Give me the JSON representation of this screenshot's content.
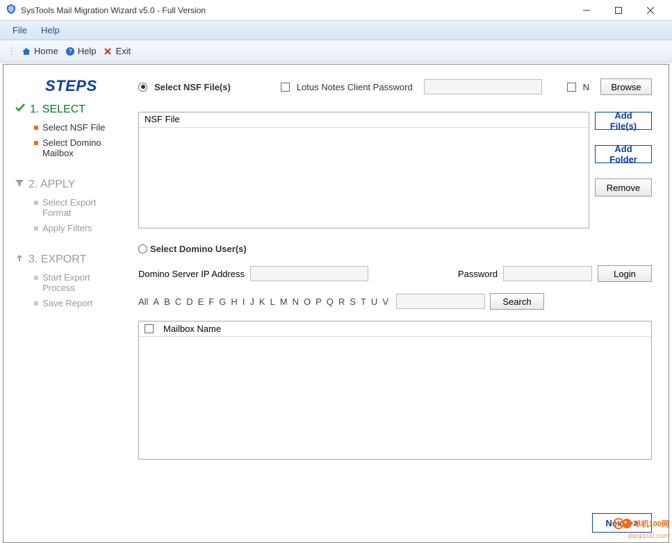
{
  "title": "SysTools Mail Migration Wizard v5.0 - Full Version",
  "menubar": {
    "file": "File",
    "help": "Help"
  },
  "toolbar": {
    "home": "Home",
    "help": "Help",
    "exit": "Exit"
  },
  "sidebar": {
    "heading": "STEPS",
    "step1": {
      "title": "1. SELECT",
      "sub1": "Select NSF File",
      "sub2": "Select Domino Mailbox"
    },
    "step2": {
      "title": "2. APPLY",
      "sub1": "Select Export Format",
      "sub2": "Apply Filters"
    },
    "step3": {
      "title": "3. EXPORT",
      "sub1": "Start Export Process",
      "sub2": "Save Report"
    }
  },
  "main": {
    "select_nsf_label": "Select NSF File(s)",
    "lotus_pw_label": "Lotus Notes Client Password",
    "n_label": "N",
    "browse": "Browse",
    "nsf_header": "NSF File",
    "add_files": "Add File(s)",
    "add_folder": "Add Folder",
    "remove": "Remove",
    "select_domino_label": "Select Domino User(s)",
    "ip_label": "Domino Server IP Address",
    "password_label": "Password",
    "login": "Login",
    "alpha_all": "All",
    "alpha": [
      "A",
      "B",
      "C",
      "D",
      "E",
      "F",
      "G",
      "H",
      "I",
      "J",
      "K",
      "L",
      "M",
      "N",
      "O",
      "P",
      "Q",
      "R",
      "S",
      "T",
      "U",
      "V"
    ],
    "search": "Search",
    "mailbox_header": "Mailbox Name",
    "next": "Next >>"
  },
  "watermark": {
    "line1": "单机100网",
    "line2": "danji100.com"
  }
}
